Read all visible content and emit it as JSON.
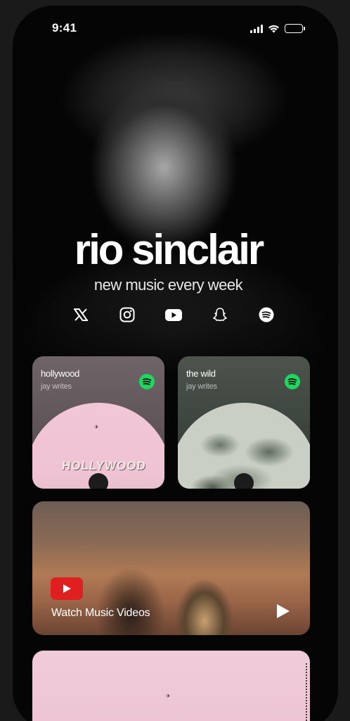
{
  "status_bar": {
    "time": "9:41"
  },
  "artist": {
    "name": "rio sinclair",
    "tagline": "new music every week"
  },
  "socials": [
    {
      "icon": "x-icon"
    },
    {
      "icon": "instagram-icon"
    },
    {
      "icon": "youtube-icon"
    },
    {
      "icon": "snapchat-icon"
    },
    {
      "icon": "spotify-icon"
    }
  ],
  "tracks": [
    {
      "title": "hollywood",
      "artist": "jay writes",
      "sign_text": "HOLLYWOOD"
    },
    {
      "title": "the wild",
      "artist": "jay writes"
    }
  ],
  "video_card": {
    "label": "Watch Music Videos"
  },
  "colors": {
    "spotify_green": "#1ed760",
    "youtube_red": "#e02020",
    "background": "#050505"
  }
}
